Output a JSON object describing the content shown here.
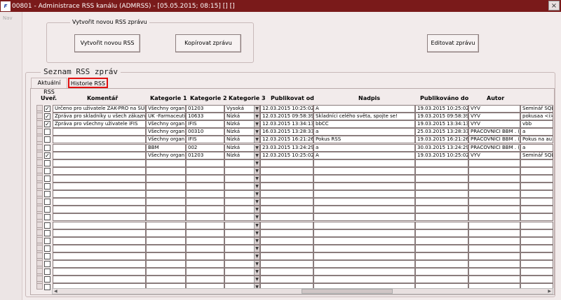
{
  "window": {
    "title": "00801 - Administrace RSS kanálu (ADMRSS) - [05.05.2015; 08:15] [] []",
    "icon_text": "F",
    "close_glyph": "×"
  },
  "nav": {
    "label": "Nav"
  },
  "group": {
    "title": "Vytvořit novou RSS zprávu",
    "create_btn": "Vytvořit novou RSS",
    "copy_btn": "Kopírovat zprávu"
  },
  "edit_btn": "Editovat zprávu",
  "section_title": "Seznam RSS zpráv",
  "tabs": [
    {
      "label": "Aktuální RSS"
    },
    {
      "label": "Historie RSS"
    }
  ],
  "columns": {
    "uver": "Uveř.",
    "komentar": "Komentář",
    "kat1": "Kategorie 1",
    "kat2": "Kategorie 2",
    "kat3": "Kategorie 3",
    "pub_od": "Publikovat od",
    "nadpis": "Nadpis",
    "pub_do": "Publikováno do",
    "autor": "Autor",
    "extra": ""
  },
  "rows": [
    {
      "checked": "✓",
      "komentar": "Určeno pro uživatele ZAK-PRO na SUI",
      "kat1": "Všechny organ",
      "kat2": "01203",
      "kat3": "Vysoká",
      "pub_od": "12.03.2015 10:25:02",
      "nadpis": "A",
      "pub_do": "19.03.2015 10:25:02",
      "autor": "VYV",
      "extra": "Seminář SQL"
    },
    {
      "checked": "✓",
      "komentar": "Zpráva pro skladníky u všech zákazní",
      "kat1": "UK -Farmaceuti",
      "kat2": "10633",
      "kat3": "Nízká",
      "pub_od": "12.03.2015 09:58:39",
      "nadpis": "Skladníci celého světa, spojte se!",
      "pub_do": "19.03.2015 09:58:39",
      "autor": "VYV",
      "extra": "pokusaa <i>"
    },
    {
      "checked": "✓",
      "komentar": "Zpráva pro všechny uživatele iFIS",
      "kat1": "Všechny organ",
      "kat2": "IFIS",
      "kat3": "Nízká",
      "pub_od": "12.03.2015 13:34:13",
      "nadpis": "bbCC",
      "pub_do": "19.03.2015 13:34:13",
      "autor": "VYV",
      "extra": "vbb"
    },
    {
      "checked": "",
      "komentar": "",
      "kat1": "Všechny organ",
      "kat2": "00310",
      "kat3": "Nízká",
      "pub_od": "16.03.2015 13:28:33",
      "nadpis": "a",
      "pub_do": "25.03.2015 13:28:33",
      "autor": "PRACOVNÍCI BBM . (",
      "extra": "a"
    },
    {
      "checked": "",
      "komentar": "",
      "kat1": "Všechny organ",
      "kat2": "IFIS",
      "kat3": "Nízká",
      "pub_od": "12.03.2015 16:21:26",
      "nadpis": "Pokus RSS",
      "pub_do": "19.03.2015 16:21:26",
      "autor": "PRACOVNÍCI BBM . (",
      "extra": "Pokus na au"
    },
    {
      "checked": "",
      "komentar": "",
      "kat1": "BBM",
      "kat2": "002",
      "kat3": "Nízká",
      "pub_od": "23.03.2015 13:24:29",
      "nadpis": "a",
      "pub_do": "30.03.2015 13:24:29",
      "autor": "PRACOVNÍCI BBM . (",
      "extra": "a"
    },
    {
      "checked": "✓",
      "komentar": "",
      "kat1": "Všechny organ",
      "kat2": "01203",
      "kat3": "Nízká",
      "pub_od": "12.03.2015 10:25:02",
      "nadpis": "A",
      "pub_do": "19.03.2015 10:25:02",
      "autor": "VYV",
      "extra": "Seminář SQL"
    }
  ]
}
